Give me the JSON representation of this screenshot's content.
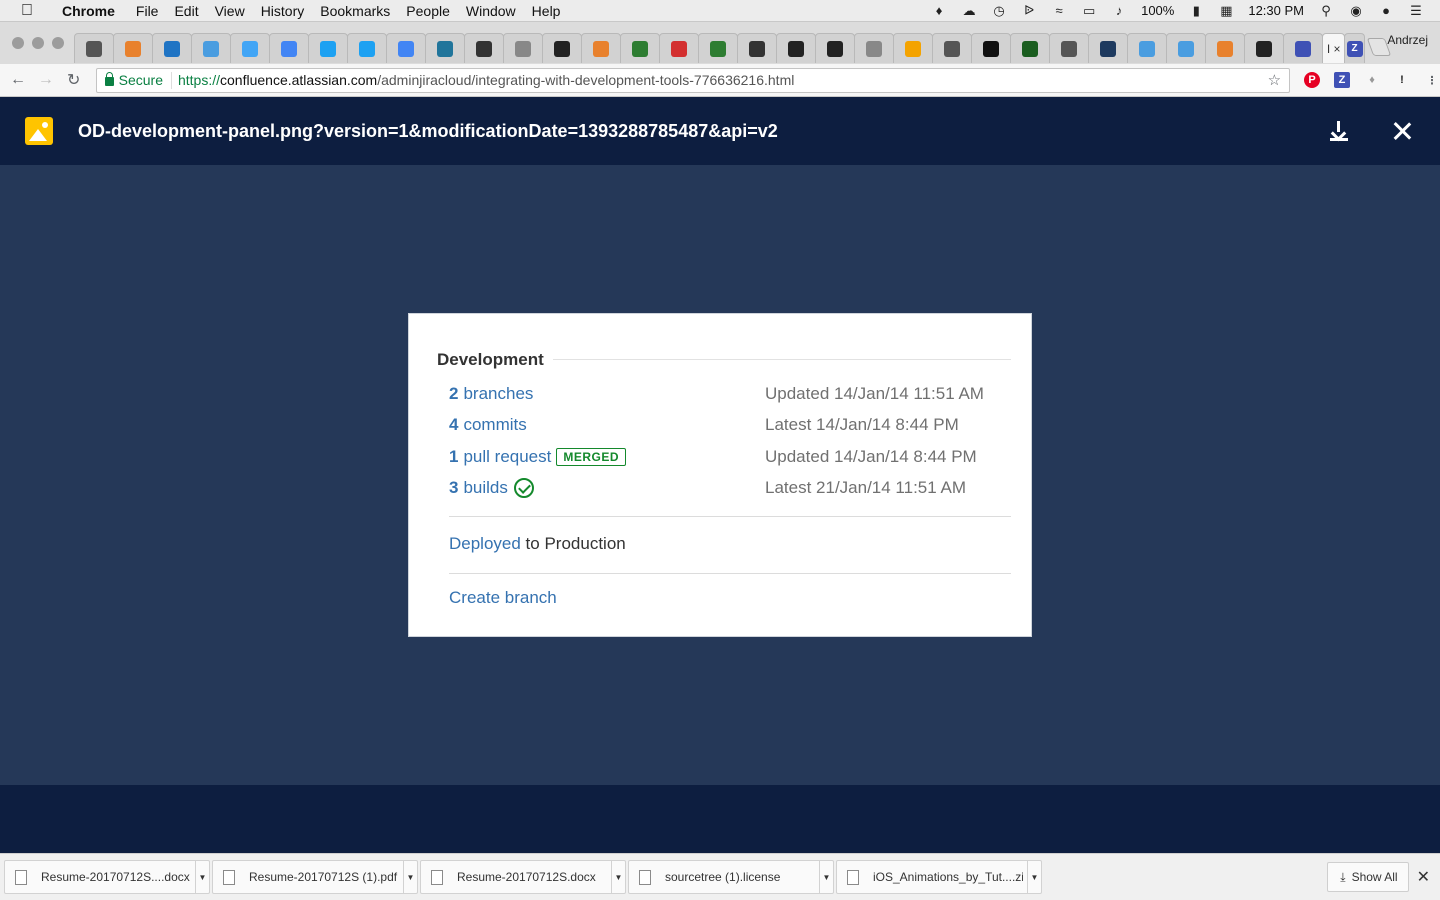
{
  "menubar": {
    "app": "Chrome",
    "items": [
      "File",
      "Edit",
      "View",
      "History",
      "Bookmarks",
      "People",
      "Window",
      "Help"
    ],
    "battery": "100%",
    "time": "12:30 PM"
  },
  "tabstrip": {
    "active_tab_label": "I ×",
    "profile": "Andrzej",
    "favicon_colors": [
      "#555",
      "#e8812d",
      "#1f74c4",
      "#4a9de0",
      "#42a5f5",
      "#4285f4",
      "#1da1f2",
      "#1da1f2",
      "#4285f4",
      "#21759b",
      "#333",
      "#888",
      "#222",
      "#e8812d",
      "#2e7d32",
      "#d32f2f",
      "#2e7d32",
      "#333",
      "#222",
      "#222",
      "#888",
      "#f4a300",
      "#555",
      "#111",
      "#1b5e20",
      "#555",
      "#1e3a5f",
      "#4a9de0",
      "#4a9de0",
      "#e8812d",
      "#222",
      "#3f51b5"
    ]
  },
  "toolbar": {
    "secure_label": "Secure",
    "url_scheme": "https://",
    "url_host": "confluence.atlassian.com",
    "url_path": "/adminjiracloud/integrating-with-development-tools-776636216.html"
  },
  "viewer": {
    "filename": "OD-development-panel.png?version=1&modificationDate=1393288785487&api=v2"
  },
  "panel": {
    "heading": "Development",
    "rows": [
      {
        "count": "2",
        "label": "branches",
        "status": "Updated 14/Jan/14 11:51 AM"
      },
      {
        "count": "4",
        "label": "commits",
        "status": "Latest 14/Jan/14 8:44 PM"
      },
      {
        "count": "1",
        "label": "pull request",
        "badge": "MERGED",
        "status": "Updated 14/Jan/14 8:44 PM"
      },
      {
        "count": "3",
        "label": "builds",
        "status": "Latest 21/Jan/14 11:51 AM"
      }
    ],
    "deployed_link": "Deployed",
    "deployed_rest": " to Production",
    "create_branch": "Create branch"
  },
  "downloads": {
    "items": [
      "Resume-20170712S....docx",
      "Resume-20170712S (1).pdf",
      "Resume-20170712S.docx",
      "sourcetree (1).license",
      "iOS_Animations_by_Tut....zip"
    ],
    "show_all": "Show All"
  }
}
